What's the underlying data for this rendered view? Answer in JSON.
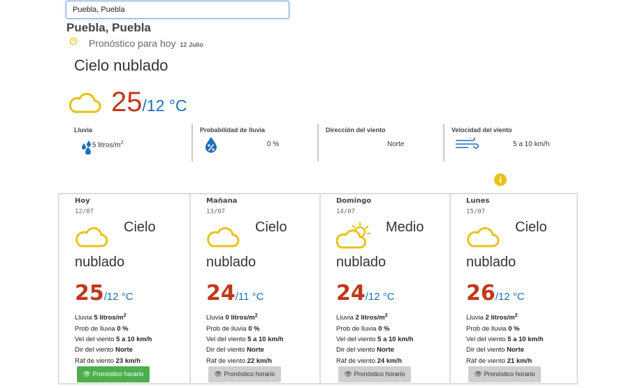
{
  "search": {
    "value": "Puebla, Puebla"
  },
  "location": {
    "title": "Puebla, Puebla"
  },
  "forecast": {
    "label": "Pronóstico para hoy",
    "date": "12 Julio",
    "condition": "Cielo nublado",
    "temp_max": "25",
    "temp_min": "/12 °C"
  },
  "stats": {
    "rain": {
      "label": "Lluvia",
      "value": "5 litros/m",
      "sup": "2"
    },
    "rain_prob": {
      "label": "Probabilidad de lluvia",
      "value": "0 %"
    },
    "wind_dir": {
      "label": "Dirección del viento",
      "value": "Norte"
    },
    "wind_speed": {
      "label": "Velocidad del viento",
      "value": "5 a 10 km/h"
    }
  },
  "row_labels": {
    "rain": "Lluvia ",
    "rain_prob": "Prob de lluvia ",
    "wind_speed": "Vel del viento ",
    "wind_dir": "Dir del viento ",
    "gust": "Ráf de viento "
  },
  "days": [
    {
      "name": "Hoy",
      "date": "12/07",
      "icon": "cloud-icon",
      "cond1": "Cielo",
      "cond2": "nublado",
      "max": "25",
      "min": "/12 °C",
      "rain": "5 litros/m",
      "rain_sup": "2",
      "prob": "0 %",
      "wind": "5 a 10 km/h",
      "dir": "Norte",
      "gust": "23 km/h",
      "button": "Pronóstico horario"
    },
    {
      "name": "Mañana",
      "date": "13/07",
      "icon": "cloud-icon",
      "cond1": "Cielo",
      "cond2": "nublado",
      "max": "24",
      "min": "/11 °C",
      "rain": "0 litros/m",
      "rain_sup": "2",
      "prob": "0 %",
      "wind": "5 a 10 km/h",
      "dir": "Norte",
      "gust": "22 km/h",
      "button": "Pronóstico horario"
    },
    {
      "name": "Domingo",
      "date": "14/07",
      "icon": "partly-cloudy-icon",
      "cond1": "Medio",
      "cond2": "nublado",
      "max": "24",
      "min": "/12 °C",
      "rain": "2 litros/m",
      "rain_sup": "2",
      "prob": "0 %",
      "wind": "5 a 10 km/h",
      "dir": "Norte",
      "gust": "24 km/h",
      "button": "Pronóstico horario"
    },
    {
      "name": "Lunes",
      "date": "15/07",
      "icon": "cloud-icon",
      "cond1": "Cielo",
      "cond2": "nublado",
      "max": "26",
      "min": "/12 °C",
      "rain": "2 litros/m",
      "rain_sup": "2",
      "prob": "0 %",
      "wind": "5 a 10 km/h",
      "dir": "Norte",
      "gust": "21 km/h",
      "button": "Pronóstico horario"
    }
  ],
  "colors": {
    "max_temp": "#c0391c",
    "min_temp": "#1d6fb8",
    "icon_yellow": "#e8c21a",
    "button_active": "#4cae4c",
    "button_inactive": "#cfcfcf"
  }
}
